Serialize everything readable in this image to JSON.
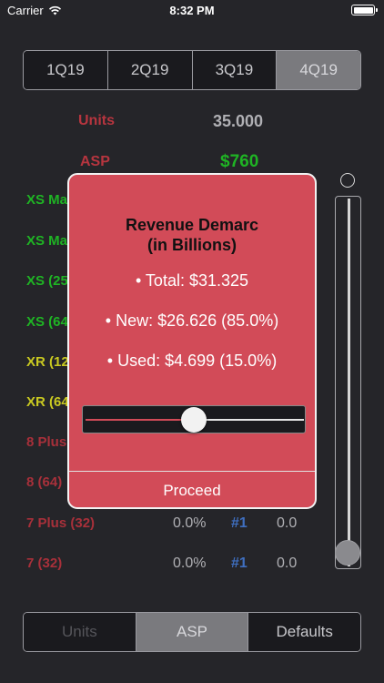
{
  "status": {
    "carrier": "Carrier",
    "time": "8:32 PM"
  },
  "quarters": [
    "1Q19",
    "2Q19",
    "3Q19",
    "4Q19"
  ],
  "selected_quarter": "4Q19",
  "header": {
    "units_label": "Units",
    "units_value": "35.000",
    "asp_label": "ASP",
    "asp_value": "$760"
  },
  "rows": [
    {
      "name": "XS Ma",
      "color": "green",
      "pct": "",
      "rank": "",
      "val": ""
    },
    {
      "name": "XS Ma",
      "color": "green",
      "pct": "",
      "rank": "",
      "val": ""
    },
    {
      "name": "XS (25",
      "color": "green",
      "pct": "",
      "rank": "",
      "val": ""
    },
    {
      "name": "XS (64",
      "color": "green",
      "pct": "",
      "rank": "",
      "val": ""
    },
    {
      "name": "XR (12",
      "color": "yellow",
      "pct": "",
      "rank": "",
      "val": ""
    },
    {
      "name": "XR (64",
      "color": "yellow",
      "pct": "",
      "rank": "",
      "val": ""
    },
    {
      "name": "8 Plus",
      "color": "red",
      "pct": "",
      "rank": "",
      "val": ""
    },
    {
      "name": "8 (64)",
      "color": "red",
      "pct": "",
      "rank": "",
      "val": ""
    },
    {
      "name": "7 Plus (32)",
      "color": "red",
      "pct": "0.0%",
      "rank": "#1",
      "val": "0.0"
    },
    {
      "name": "7 (32)",
      "color": "red",
      "pct": "0.0%",
      "rank": "#1",
      "val": "0.0"
    }
  ],
  "modal": {
    "title_line1": "Revenue Demarc",
    "title_line2": "(in Billions)",
    "total": "• Total: $31.325",
    "new": "• New: $26.626 (85.0%)",
    "used": "• Used: $4.699 (15.0%)",
    "split_fraction": 0.5,
    "proceed": "Proceed"
  },
  "bottom_tabs": [
    "Units",
    "ASP",
    "Defaults"
  ],
  "selected_bottom_tab": "ASP",
  "colors": {
    "accent_red": "#d24b58",
    "green": "#1fb424",
    "yellow": "#c9c921",
    "dark_red": "#a8303a",
    "rank_blue": "#3f6fc0"
  }
}
